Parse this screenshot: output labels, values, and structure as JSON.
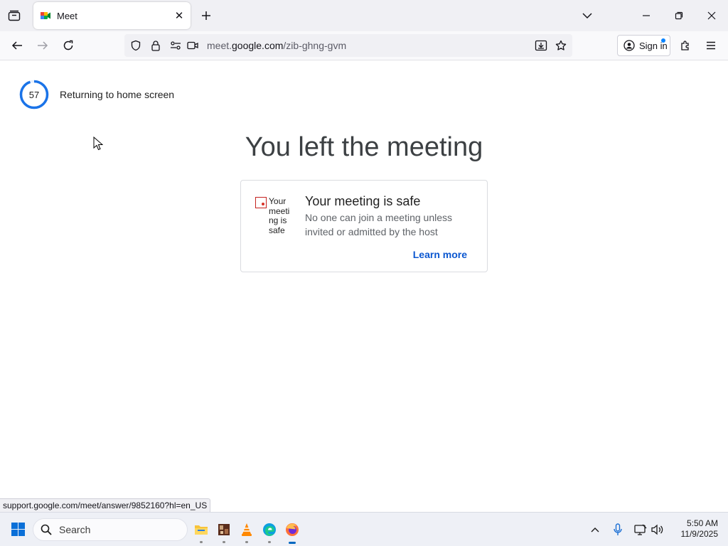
{
  "tab": {
    "title": "Meet",
    "favicon": "google-meet-icon"
  },
  "address_bar": {
    "url_prefix": "meet.",
    "url_domain": "google.com",
    "url_path": "/zib-ghng-gvm"
  },
  "toolbar": {
    "signin_label": "Sign in"
  },
  "page": {
    "countdown_value": "57",
    "countdown_progress": 0.95,
    "returning_text": "Returning to home screen",
    "headline": "You left the meeting",
    "card": {
      "image_alt": "Your meeting is safe",
      "title": "Your meeting is safe",
      "body": "No one can join a meeting unless invited or admitted by the host",
      "link": "Learn more"
    }
  },
  "status_url": "support.google.com/meet/answer/9852160?hl=en_US",
  "taskbar": {
    "search_label": "Search",
    "apps": [
      "file-explorer-icon",
      "photo-app-icon",
      "vlc-icon",
      "edge-icon",
      "firefox-icon"
    ],
    "clock_time": "5:50 AM",
    "clock_date": "11/9/2025"
  },
  "colors": {
    "accent_blue": "#1a73e8",
    "link": "#0b57d0",
    "headline": "#3c4043"
  }
}
